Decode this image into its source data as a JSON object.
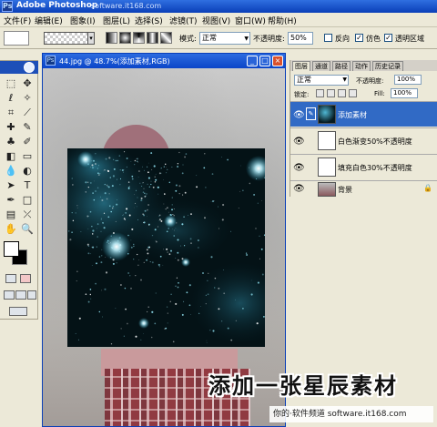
{
  "app": {
    "title": "Adobe Photoshop",
    "watermark": "software.it168.com",
    "logo_letters": "Ps"
  },
  "menu": [
    "文件(F)",
    "编辑(E)",
    "图象(I)",
    "图层(L)",
    "选择(S)",
    "滤镜(T)",
    "视图(V)",
    "窗口(W)",
    "帮助(H)"
  ],
  "options": {
    "mode_label": "模式:",
    "mode_value": "正常",
    "opacity_label": "不透明度:",
    "opacity_value": "50%",
    "reverse_label": "反向",
    "reverse_checked": false,
    "dither_label": "仿色",
    "dither_checked": true,
    "transparency_label": "透明区域",
    "transparency_checked": true
  },
  "document": {
    "title": "44.jpg @ 48.7%(添加素材,RGB)",
    "zoom": "48.7%",
    "buttons": {
      "minimize": "_",
      "maximize": "□",
      "close": "×"
    }
  },
  "layers_panel": {
    "tabs": [
      "图层",
      "通道",
      "路径",
      "动作",
      "历史记录"
    ],
    "active_tab": "图层",
    "blend_mode": "正常",
    "opacity_label": "不透明度:",
    "opacity_value": "100%",
    "lock_label": "锁定:",
    "fill_label": "Fill:",
    "fill_value": "100%",
    "layers": [
      {
        "name": "添加素材",
        "selected": true,
        "visible": true,
        "thumb": "stars"
      },
      {
        "name": "白色渐变50%不透明度",
        "selected": false,
        "visible": true,
        "thumb": "white"
      },
      {
        "name": "填充白色30%不透明度",
        "selected": false,
        "visible": true,
        "thumb": "white"
      },
      {
        "name": "背景",
        "selected": false,
        "visible": true,
        "thumb": "photo",
        "locked": true
      }
    ]
  },
  "caption": "添加一张星辰素材",
  "credit": "你的·软件频道 software.it168.com",
  "colors": {
    "foreground": "#ffffff",
    "background": "#000000",
    "selection": "#316ac5"
  }
}
